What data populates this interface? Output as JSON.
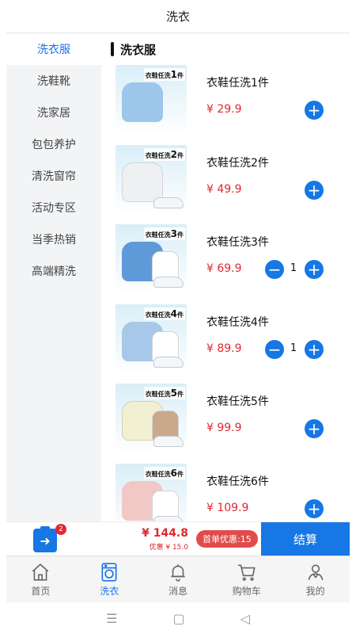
{
  "header": {
    "title": "洗衣"
  },
  "sidebar": {
    "items": [
      {
        "label": "洗衣服",
        "active": true
      },
      {
        "label": "洗鞋靴"
      },
      {
        "label": "洗家居"
      },
      {
        "label": "包包养护"
      },
      {
        "label": "清洗窗帘"
      },
      {
        "label": "活动专区"
      },
      {
        "label": "当季热销"
      },
      {
        "label": "高端精洗"
      }
    ]
  },
  "category": {
    "title": "洗衣服"
  },
  "products": [
    {
      "name": "衣鞋任洗1件",
      "price": "¥ 29.9",
      "qty": null,
      "tag_num": "1",
      "tag_unit": "件",
      "jacket_color": "#9cc6ea"
    },
    {
      "name": "衣鞋任洗2件",
      "price": "¥ 49.9",
      "qty": null,
      "tag_num": "2",
      "tag_unit": "件",
      "jacket_color": "#eef0f2"
    },
    {
      "name": "衣鞋任洗3件",
      "price": "¥ 69.9",
      "qty": "1",
      "tag_num": "3",
      "tag_unit": "件",
      "jacket_color": "#5f9ad8"
    },
    {
      "name": "衣鞋任洗4件",
      "price": "¥ 89.9",
      "qty": "1",
      "tag_num": "4",
      "tag_unit": "件",
      "jacket_color": "#a7c8e8"
    },
    {
      "name": "衣鞋任洗5件",
      "price": "¥ 99.9",
      "qty": null,
      "tag_num": "5",
      "tag_unit": "件",
      "jacket_color": "#f3efd2"
    },
    {
      "name": "衣鞋任洗6件",
      "price": "¥ 109.9",
      "qty": null,
      "tag_num": "6",
      "tag_unit": "件",
      "jacket_color": "#f2c8c6"
    }
  ],
  "tag_prefix": "衣鞋任洗",
  "cart": {
    "badge": "2",
    "total": "¥ 144.8",
    "discount": "优惠 ¥ 15.0",
    "promo": "首单优惠:15",
    "checkout": "结算"
  },
  "tabs": [
    {
      "label": "首页",
      "icon": "home-icon"
    },
    {
      "label": "洗衣",
      "icon": "washing-machine-icon",
      "active": true
    },
    {
      "label": "消息",
      "icon": "bell-icon"
    },
    {
      "label": "购物车",
      "icon": "cart-icon"
    },
    {
      "label": "我的",
      "icon": "user-icon"
    }
  ],
  "system_nav": {
    "menu": "☰",
    "home": "▢",
    "back": "◁"
  },
  "colors": {
    "accent": "#1677e5",
    "price": "#e0282e",
    "promo": "#e24b4b"
  }
}
